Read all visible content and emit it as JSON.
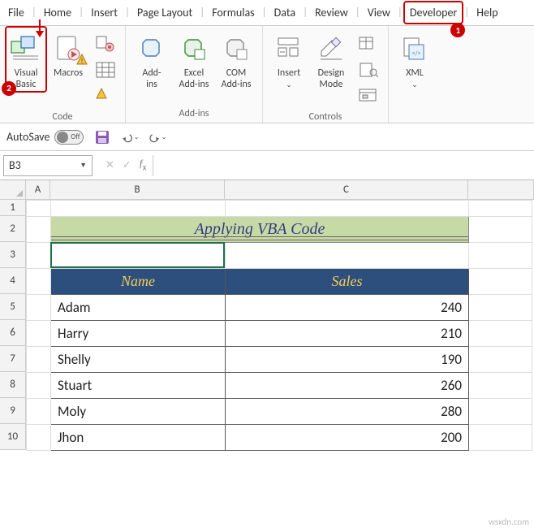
{
  "tabs": {
    "file": "File",
    "home": "Home",
    "insert": "Insert",
    "pageLayout": "Page Layout",
    "formulas": "Formulas",
    "data": "Data",
    "review": "Review",
    "view": "View",
    "developer": "Developer",
    "help": "Help"
  },
  "badges": {
    "dev": "1",
    "vba": "2"
  },
  "ribbon": {
    "code": {
      "visualBasic": "Visual\nBasic",
      "macros": "Macros",
      "groupLabel": "Code"
    },
    "addins": {
      "addins": "Add-\nins",
      "excelAddins": "Excel\nAdd-ins",
      "comAddins": "COM\nAdd-ins",
      "groupLabel": "Add-ins"
    },
    "controls": {
      "insert": "Insert",
      "designMode": "Design\nMode",
      "groupLabel": "Controls"
    },
    "xml": {
      "xml": "XML",
      "groupLabel": ""
    }
  },
  "qat": {
    "autoSave": "AutoSave",
    "toggleState": "Off"
  },
  "nameBox": {
    "value": "B3"
  },
  "columns": {
    "A": "A",
    "B": "B",
    "C": "C"
  },
  "rows": [
    "1",
    "2",
    "3",
    "4",
    "5",
    "6",
    "7",
    "8",
    "9",
    "10"
  ],
  "sheet": {
    "title": "Applying VBA Code",
    "headers": {
      "name": "Name",
      "sales": "Sales"
    },
    "data": [
      {
        "name": "Adam",
        "sales": "240"
      },
      {
        "name": "Harry",
        "sales": "210"
      },
      {
        "name": "Shelly",
        "sales": "190"
      },
      {
        "name": "Stuart",
        "sales": "260"
      },
      {
        "name": "Moly",
        "sales": "280"
      },
      {
        "name": "Jhon",
        "sales": "200"
      }
    ]
  },
  "watermark": "wsxdn.com"
}
